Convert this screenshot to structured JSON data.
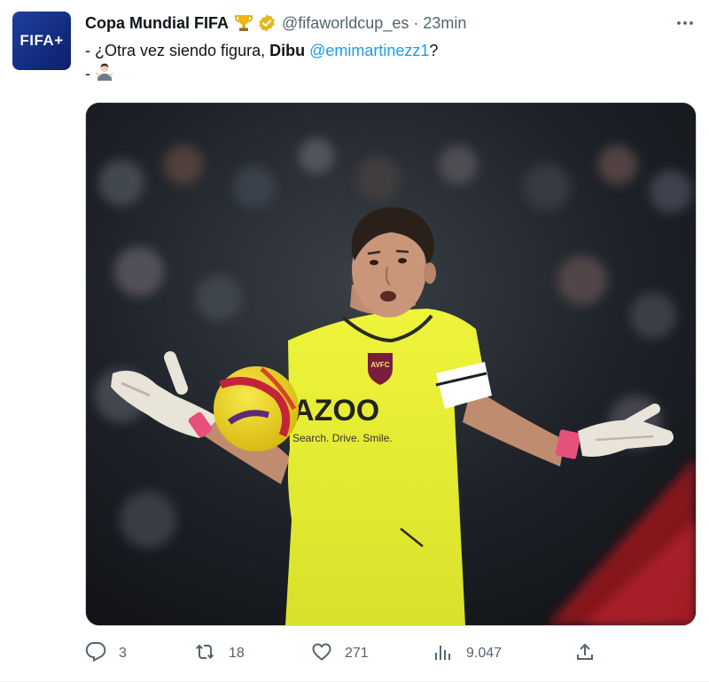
{
  "account": {
    "avatar_logo": "FIFA+",
    "display_name": "Copa Mundial FIFA",
    "handle": "@fifaworldcup_es",
    "separator": "·",
    "timestamp": "23min",
    "badge_icon": "trophy-icon",
    "verified_icon": "verified-gold-icon"
  },
  "tweet": {
    "line1_prefix": "- ¿Otra vez siendo figura, ",
    "line1_bold": "Dibu",
    "line1_mention": "@emimartinezz1",
    "line1_suffix": "?",
    "line2_prefix": "- ",
    "line2_emoji_icon": "person-shrugging-icon"
  },
  "media": {
    "shirt_text": "AZOO",
    "shirt_tagline": "Search. Drive. Smile.",
    "crest_text": "AVFC"
  },
  "actions": {
    "reply_count": "3",
    "retweet_count": "18",
    "like_count": "271",
    "views_count": "9.047"
  },
  "colors": {
    "link": "#1d9bf0",
    "secondary_text": "#536471",
    "primary_text": "#0f1419",
    "verified_gold": "#e2b719",
    "jersey_yellow": "#e7f22e"
  }
}
